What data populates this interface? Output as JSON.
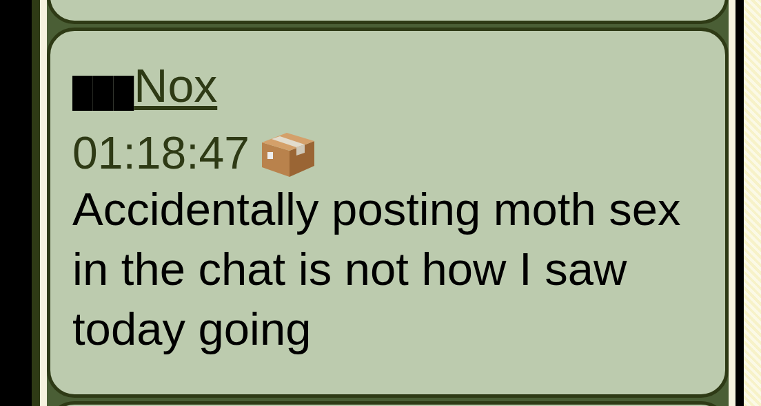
{
  "message": {
    "redaction": "███",
    "author": "Nox",
    "time": "01:18:47",
    "text": "Accidentally posting moth sex in the chat is not how I saw today going"
  }
}
